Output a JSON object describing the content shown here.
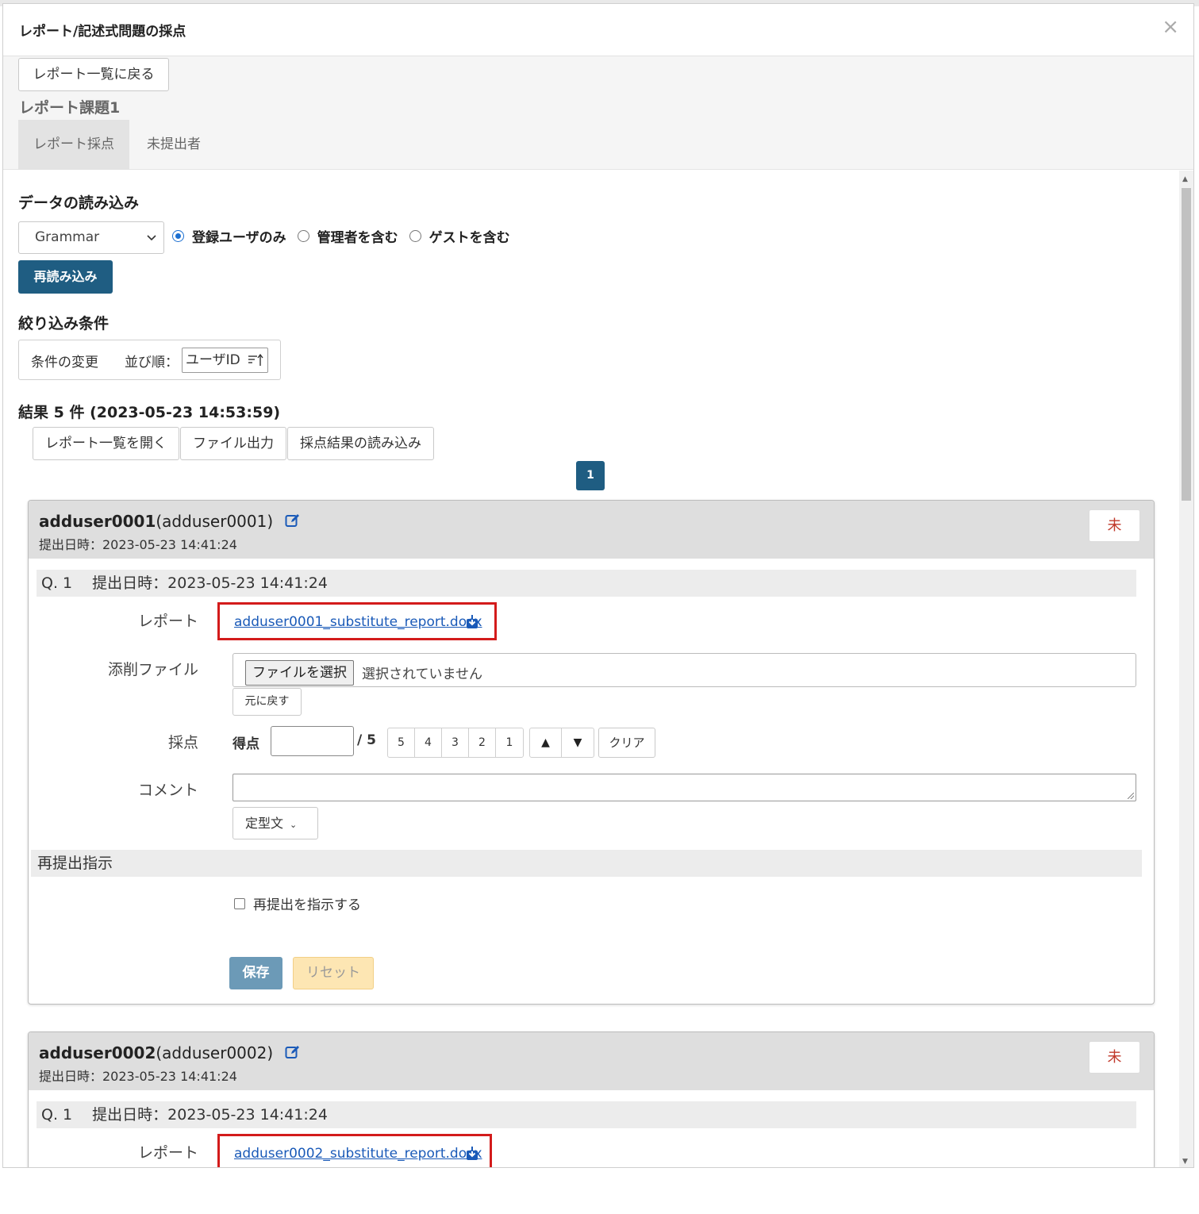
{
  "modal": {
    "title": "レポート/記述式問題の採点",
    "close_symbol": "×"
  },
  "top": {
    "back_label": "レポート一覧に戻る",
    "assignment_title": "レポート課題1",
    "tabs": [
      {
        "label": "レポート採点",
        "active": true
      },
      {
        "label": "未提出者",
        "active": false
      }
    ]
  },
  "load": {
    "heading": "データの読み込み",
    "select_value": "Grammar",
    "radios": [
      {
        "label": "登録ユーザのみ",
        "checked": true
      },
      {
        "label": "管理者を含む",
        "checked": false
      },
      {
        "label": "ゲストを含む",
        "checked": false
      }
    ],
    "reload_label": "再読み込み"
  },
  "filter": {
    "heading": "絞り込み条件",
    "change_label": "条件の変更",
    "order_label": "並び順：",
    "order_value": "ユーザID"
  },
  "results": {
    "summary": "結果 5 件 (2023-05-23 14:53:59)",
    "actions": [
      "レポート一覧を開く",
      "ファイル出力",
      "採点結果の読み込み"
    ],
    "current_page": "1"
  },
  "labels": {
    "q_prefix": "Q. 1　 提出日時：",
    "report": "レポート",
    "attachment": "添削ファイル",
    "file_choose": "ファイルを選択",
    "file_none": "選択されていません",
    "revert": "元に戻す",
    "scoring": "採点",
    "score": "得点",
    "score_max": "/ 5",
    "score_buttons": [
      "5",
      "4",
      "3",
      "2",
      "1"
    ],
    "up": "▲",
    "down": "▼",
    "clear": "クリア",
    "comment": "コメント",
    "template": "定型文",
    "resubmit_heading": "再提出指示",
    "resubmit_check": "再提出を指示する",
    "save": "保存",
    "reset": "リセット",
    "status": "未",
    "submitted_prefix": "提出日時："
  },
  "submissions": [
    {
      "user": "adduser0001",
      "user_paren": "(adduser0001)",
      "submitted": "提出日時：2023-05-23 14:41:24",
      "q_line": "Q. 1　 提出日時：2023-05-23 14:41:24",
      "file": "adduser0001_substitute_report.docx"
    },
    {
      "user": "adduser0002",
      "user_paren": "(adduser0002)",
      "submitted": "提出日時：2023-05-23 14:41:24",
      "q_line": "Q. 1　 提出日時：2023-05-23 14:41:24",
      "file": "adduser0002_substitute_report.docx"
    }
  ],
  "colors": {
    "primary": "#1f5d82",
    "highlight": "#d31b1b",
    "link": "#1a5ab8",
    "status": "#c0392b"
  },
  "icons": {
    "edit": "edit-icon",
    "download": "download-icon",
    "sort": "sort-ascending-icon"
  }
}
